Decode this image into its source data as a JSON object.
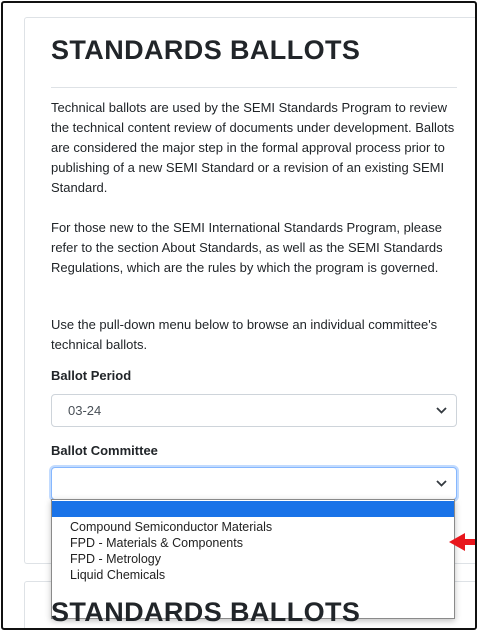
{
  "page": {
    "title": "STANDARDS BALLOTS",
    "title_repeat": "STANDARDS BALLOTS",
    "paragraphs": [
      "Technical ballots are used by the SEMI Standards Program to review the technical content review of documents under development. Ballots are considered the major step in the formal approval process prior to publishing of a new SEMI Standard or a revision of an existing SEMI Standard.",
      "For those new to the SEMI International Standards Program, please refer to the section About Standards, as well as the SEMI Standards Regulations, which are the rules by which the program is governed.",
      "Use the pull-down menu below to browse an individual committee's technical ballots."
    ]
  },
  "ballot_period": {
    "label": "Ballot Period",
    "selected": "03-24"
  },
  "ballot_committee": {
    "label": "Ballot Committee",
    "selected": "",
    "options": [
      "",
      "Compound Semiconductor Materials",
      "FPD - Materials & Components",
      "FPD - Metrology",
      "Liquid Chemicals"
    ]
  },
  "colors": {
    "highlight": "#1a73e8",
    "arrow": "#e8161c",
    "focus_border": "#86b7fe"
  },
  "icons": [
    "chevron-down-icon",
    "red-arrow-icon"
  ]
}
